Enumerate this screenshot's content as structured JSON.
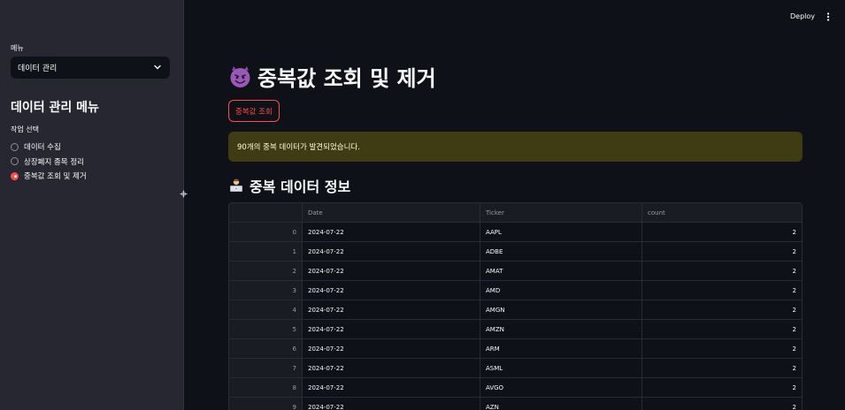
{
  "sidebar": {
    "select_label": "메뉴",
    "select_value": "데이터 관리",
    "heading": "데이터 관리 메뉴",
    "radio_label": "작업 선택",
    "radio_options": [
      {
        "label": "데이터 수집",
        "selected": false
      },
      {
        "label": "상장폐지 종목 정리",
        "selected": false
      },
      {
        "label": "중복값 조회 및 제거",
        "selected": true
      }
    ]
  },
  "header": {
    "deploy_label": "Deploy"
  },
  "main": {
    "title_emoji": "smiling-devil-icon",
    "title": "중복값 조회 및 제거",
    "button_label": "중복값 조회",
    "alert_text": "90개의 중복 데이터가 발견되었습니다.",
    "subheading_emoji": "person-at-computer-icon",
    "subheading": "중복 데이터 정보"
  },
  "table": {
    "columns": [
      "",
      "Date",
      "Ticker",
      "count"
    ],
    "rows": [
      [
        "0",
        "2024-07-22",
        "AAPL",
        "2"
      ],
      [
        "1",
        "2024-07-22",
        "ADBE",
        "2"
      ],
      [
        "2",
        "2024-07-22",
        "AMAT",
        "2"
      ],
      [
        "3",
        "2024-07-22",
        "AMD",
        "2"
      ],
      [
        "4",
        "2024-07-22",
        "AMGN",
        "2"
      ],
      [
        "5",
        "2024-07-22",
        "AMZN",
        "2"
      ],
      [
        "6",
        "2024-07-22",
        "ARM",
        "2"
      ],
      [
        "7",
        "2024-07-22",
        "ASML",
        "2"
      ],
      [
        "8",
        "2024-07-22",
        "AVGO",
        "2"
      ],
      [
        "9",
        "2024-07-22",
        "AZN",
        "2"
      ]
    ]
  },
  "colors": {
    "accent": "#ff4b4b",
    "background": "#0e1117",
    "sidebar": "#262730",
    "alert_bg": "#3f3b12"
  }
}
